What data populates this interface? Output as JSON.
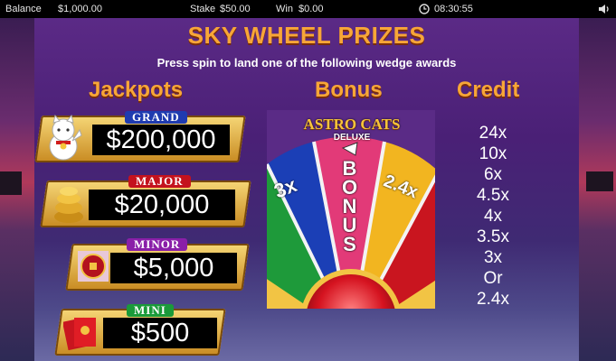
{
  "topbar": {
    "balance_label": "Balance",
    "balance_value": "$1,000.00",
    "stake_label": "Stake",
    "stake_value": "$50.00",
    "win_label": "Win",
    "win_value": "$0.00",
    "clock": "08:30:55"
  },
  "panel": {
    "title": "SKY WHEEL PRIZES",
    "subtitle": "Press spin to land one of the following wedge awards",
    "headers": {
      "jackpots": "Jackpots",
      "bonus": "Bonus",
      "credit": "Credit"
    }
  },
  "jackpots": [
    {
      "name": "GRAND",
      "amount": "$200,000",
      "badge_color": "#1f3bb0"
    },
    {
      "name": "MAJOR",
      "amount": "$20,000",
      "badge_color": "#c4121e"
    },
    {
      "name": "MINOR",
      "amount": "$5,000",
      "badge_color": "#8a1fa8"
    },
    {
      "name": "MINI",
      "amount": "$500",
      "badge_color": "#1a9a3a"
    }
  ],
  "wheel": {
    "logo_line1": "ASTRO CATS",
    "logo_line2": "DELUXE",
    "wedge_left": "3x",
    "wedge_center": "BONUS",
    "wedge_right": "2.4x"
  },
  "credits": [
    "24x",
    "10x",
    "6x",
    "4.5x",
    "4x",
    "3.5x",
    "3x",
    "Or",
    "2.4x"
  ],
  "colors": {
    "title_orange": "#f7a637",
    "panel_purple": "#4a2076"
  }
}
